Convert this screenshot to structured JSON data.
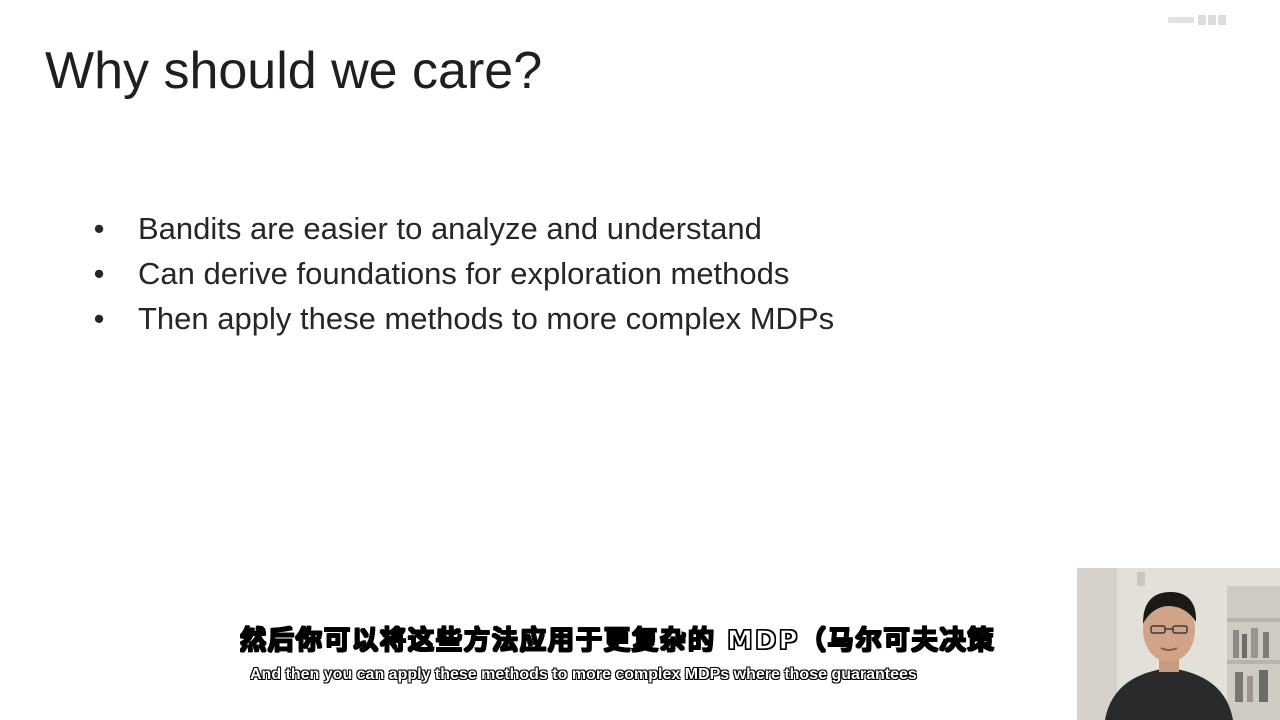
{
  "slide": {
    "title": "Why should we care?",
    "bullet_marker": "•",
    "bullets": [
      "Bandits are easier to analyze and understand",
      "Can derive foundations for exploration methods",
      "Then apply these methods to more complex MDPs"
    ]
  },
  "subtitles": {
    "chinese": "然后你可以将这些方法应用于更复杂的 MDP（马尔可夫决策",
    "english": "And then you can apply these methods to more complex MDPs where those guarantees"
  },
  "colors": {
    "background": "#ffffff",
    "text": "#262626",
    "subtitle_fill": "#ffffff",
    "subtitle_outline": "#000000"
  },
  "icons": {
    "webcam": "presenter-webcam-feed"
  }
}
